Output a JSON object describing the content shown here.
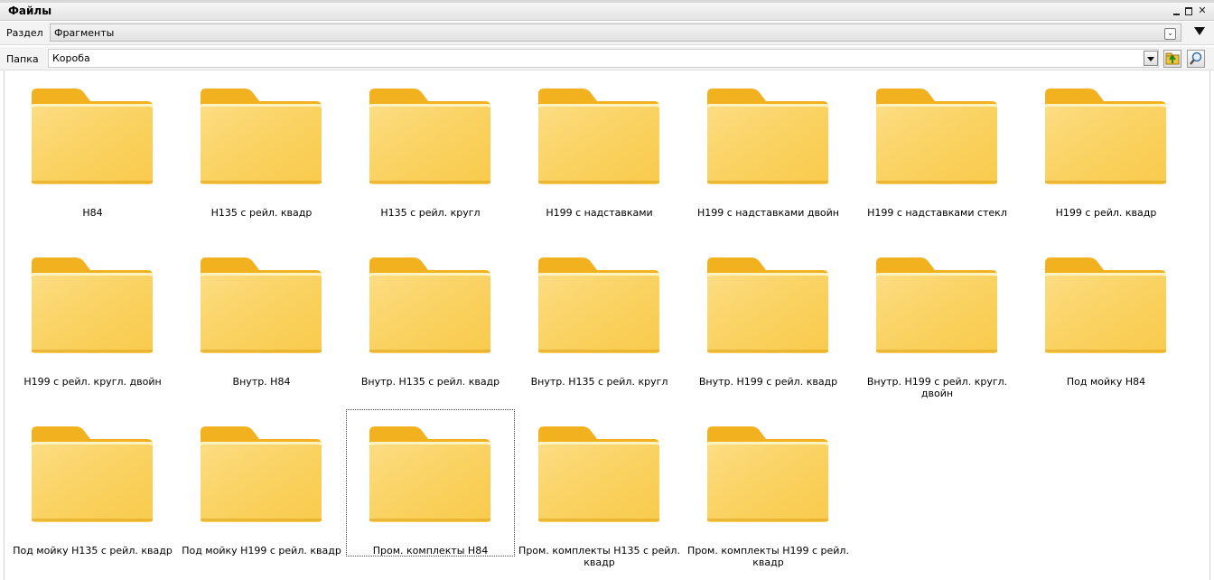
{
  "window": {
    "title": "Файлы"
  },
  "section": {
    "label": "Раздел",
    "value": "Фрагменты"
  },
  "folder": {
    "label": "Папка",
    "value": "Короба"
  },
  "items": [
    "Н84",
    "Н135 с рейл. квадр",
    "Н135 с рейл. кругл",
    "Н199 с надставками",
    "Н199 с надставками двойн",
    "Н199 с надставками стекл",
    "Н199 с рейл. квадр",
    "Н199 с рейл. кругл. двойн",
    "Внутр. Н84",
    "Внутр. Н135 с рейл. квадр",
    "Внутр. Н135 с рейл. кругл",
    "Внутр. Н199 с рейл. квадр",
    "Внутр. Н199 с рейл. кругл. двойн",
    "Под мойку Н84",
    "Под мойку Н135 с рейл. квадр",
    "Под мойку Н199 с рейл. квадр",
    "Пром. комплекты Н84",
    "Пром. комплекты Н135 с рейл. квадр",
    "Пром. комплекты Н199 с рейл. квадр"
  ],
  "selected_index": 16,
  "colors": {
    "folder_back": "#f2b21f",
    "folder_front": "#fcd25b",
    "folder_light": "#fff3c2"
  }
}
